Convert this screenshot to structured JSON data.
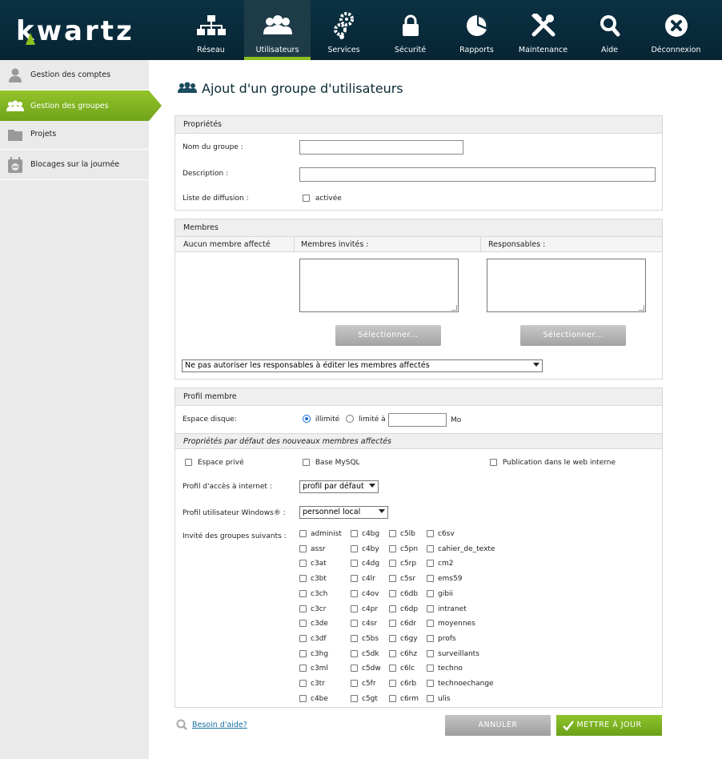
{
  "app": {
    "logo": "kwartz"
  },
  "nav": [
    {
      "label": "Réseau",
      "icon": "network-icon"
    },
    {
      "label": "Utilisateurs",
      "icon": "users-icon"
    },
    {
      "label": "Services",
      "icon": "gears-icon"
    },
    {
      "label": "Sécurité",
      "icon": "lock-icon"
    },
    {
      "label": "Rapports",
      "icon": "pie-chart-icon"
    },
    {
      "label": "Maintenance",
      "icon": "tools-icon"
    },
    {
      "label": "Aide",
      "icon": "search-icon"
    },
    {
      "label": "Déconnexion",
      "icon": "close-circle-icon"
    }
  ],
  "sidebar": [
    {
      "label": "Gestion des comptes",
      "icon": "user-icon"
    },
    {
      "label": "Gestion des groupes",
      "icon": "group-icon"
    },
    {
      "label": "Projets",
      "icon": "folder-icon"
    },
    {
      "label": "Blocages sur la journée",
      "icon": "calendar-block-icon"
    }
  ],
  "page": {
    "title": "Ajout d'un groupe d'utilisateurs"
  },
  "properties": {
    "header": "Propriétés",
    "name_label": "Nom du groupe :",
    "name_value": "",
    "desc_label": "Description :",
    "desc_value": "",
    "diffusion_label": "Liste de diffusion :",
    "diffusion_check": "activée"
  },
  "members": {
    "header": "Membres",
    "col1": "Aucun membre affecté",
    "col2": "Membres invités :",
    "col3": "Responsables :",
    "select_btn": "Sélectionner...",
    "policy_select": "Ne pas autoriser les responsables à éditer les membres affectés"
  },
  "profile": {
    "header": "Profil membre",
    "disk_label": "Espace disque:",
    "unlimited": "illimité",
    "limited": "limité à",
    "limit_value": "",
    "unit": "Mo",
    "defaults_header": "Propriétés par défaut des nouveaux membres affectés",
    "private_space": "Espace privé",
    "mysql": "Base MySQL",
    "web_pub": "Publication dans le web interne",
    "internet_label": "Profil d'accès à internet :",
    "internet_value": "profil par défaut",
    "windows_label": "Profil utilisateur Windows® :",
    "windows_value": "personnel local",
    "groups_label": "Invité des groupes suivants :",
    "groups": [
      [
        "administ",
        "c4bg",
        "c5lb",
        "c6sv"
      ],
      [
        "assr",
        "c4by",
        "c5pn",
        "cahier_de_texte"
      ],
      [
        "c3at",
        "c4dg",
        "c5rp",
        "cm2"
      ],
      [
        "c3bt",
        "c4lr",
        "c5sr",
        "ems59"
      ],
      [
        "c3ch",
        "c4ov",
        "c6db",
        "gibii"
      ],
      [
        "c3cr",
        "c4pr",
        "c6dp",
        "intranet"
      ],
      [
        "c3de",
        "c4sr",
        "c6dr",
        "moyennes"
      ],
      [
        "c3df",
        "c5bs",
        "c6gy",
        "profs"
      ],
      [
        "c3hg",
        "c5dk",
        "c6hz",
        "surveillants"
      ],
      [
        "c3ml",
        "c5dw",
        "c6lc",
        "techno"
      ],
      [
        "c3tr",
        "c5fr",
        "c6rb",
        "technoechange"
      ],
      [
        "c4be",
        "c5gt",
        "c6rm",
        "ulis"
      ]
    ]
  },
  "footer": {
    "help": "Besoin d'aide?",
    "cancel": "ANNULER",
    "submit": "METTRE À JOUR"
  }
}
